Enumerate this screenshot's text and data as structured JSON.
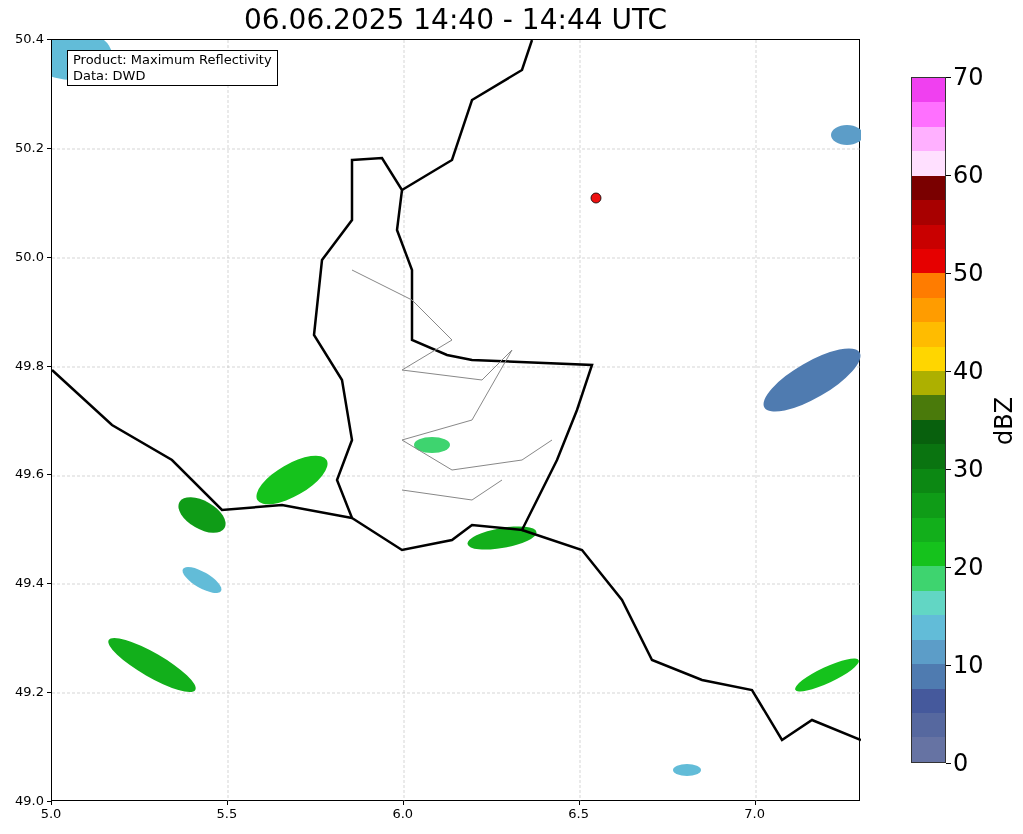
{
  "title": "06.06.2025 14:40 - 14:44 UTC",
  "info_box": [
    "Product: Maximum Reflectivity",
    "Data: DWD"
  ],
  "x_ticks": [
    "5.0",
    "5.5",
    "6.0",
    "6.5",
    "7.0"
  ],
  "y_ticks": [
    "50.4",
    "50.2",
    "50.0",
    "49.8",
    "49.6",
    "49.4",
    "49.2",
    "49.0"
  ],
  "colorbar": {
    "label": "dBZ",
    "ticks": [
      "70",
      "60",
      "50",
      "40",
      "30",
      "20",
      "10",
      "0"
    ],
    "segments": [
      {
        "color": "#f040f0"
      },
      {
        "color": "#ff70ff"
      },
      {
        "color": "#ffb0ff"
      },
      {
        "color": "#ffe0ff"
      },
      {
        "color": "#7a0000"
      },
      {
        "color": "#a80000"
      },
      {
        "color": "#c90000"
      },
      {
        "color": "#e60000"
      },
      {
        "color": "#ff7c00"
      },
      {
        "color": "#ff9c00"
      },
      {
        "color": "#ffbc00"
      },
      {
        "color": "#ffd600"
      },
      {
        "color": "#adb000"
      },
      {
        "color": "#4a7a0b"
      },
      {
        "color": "#08600d"
      },
      {
        "color": "#0a7410"
      },
      {
        "color": "#0c8813"
      },
      {
        "color": "#0f9c17"
      },
      {
        "color": "#12af1b"
      },
      {
        "color": "#15c21c"
      },
      {
        "color": "#3ed46f"
      },
      {
        "color": "#62d6c4"
      },
      {
        "color": "#62bcd8"
      },
      {
        "color": "#5c9dc8"
      },
      {
        "color": "#4f7bb0"
      },
      {
        "color": "#45599c"
      },
      {
        "color": "#56689f"
      },
      {
        "color": "#6673a3"
      }
    ]
  }
}
